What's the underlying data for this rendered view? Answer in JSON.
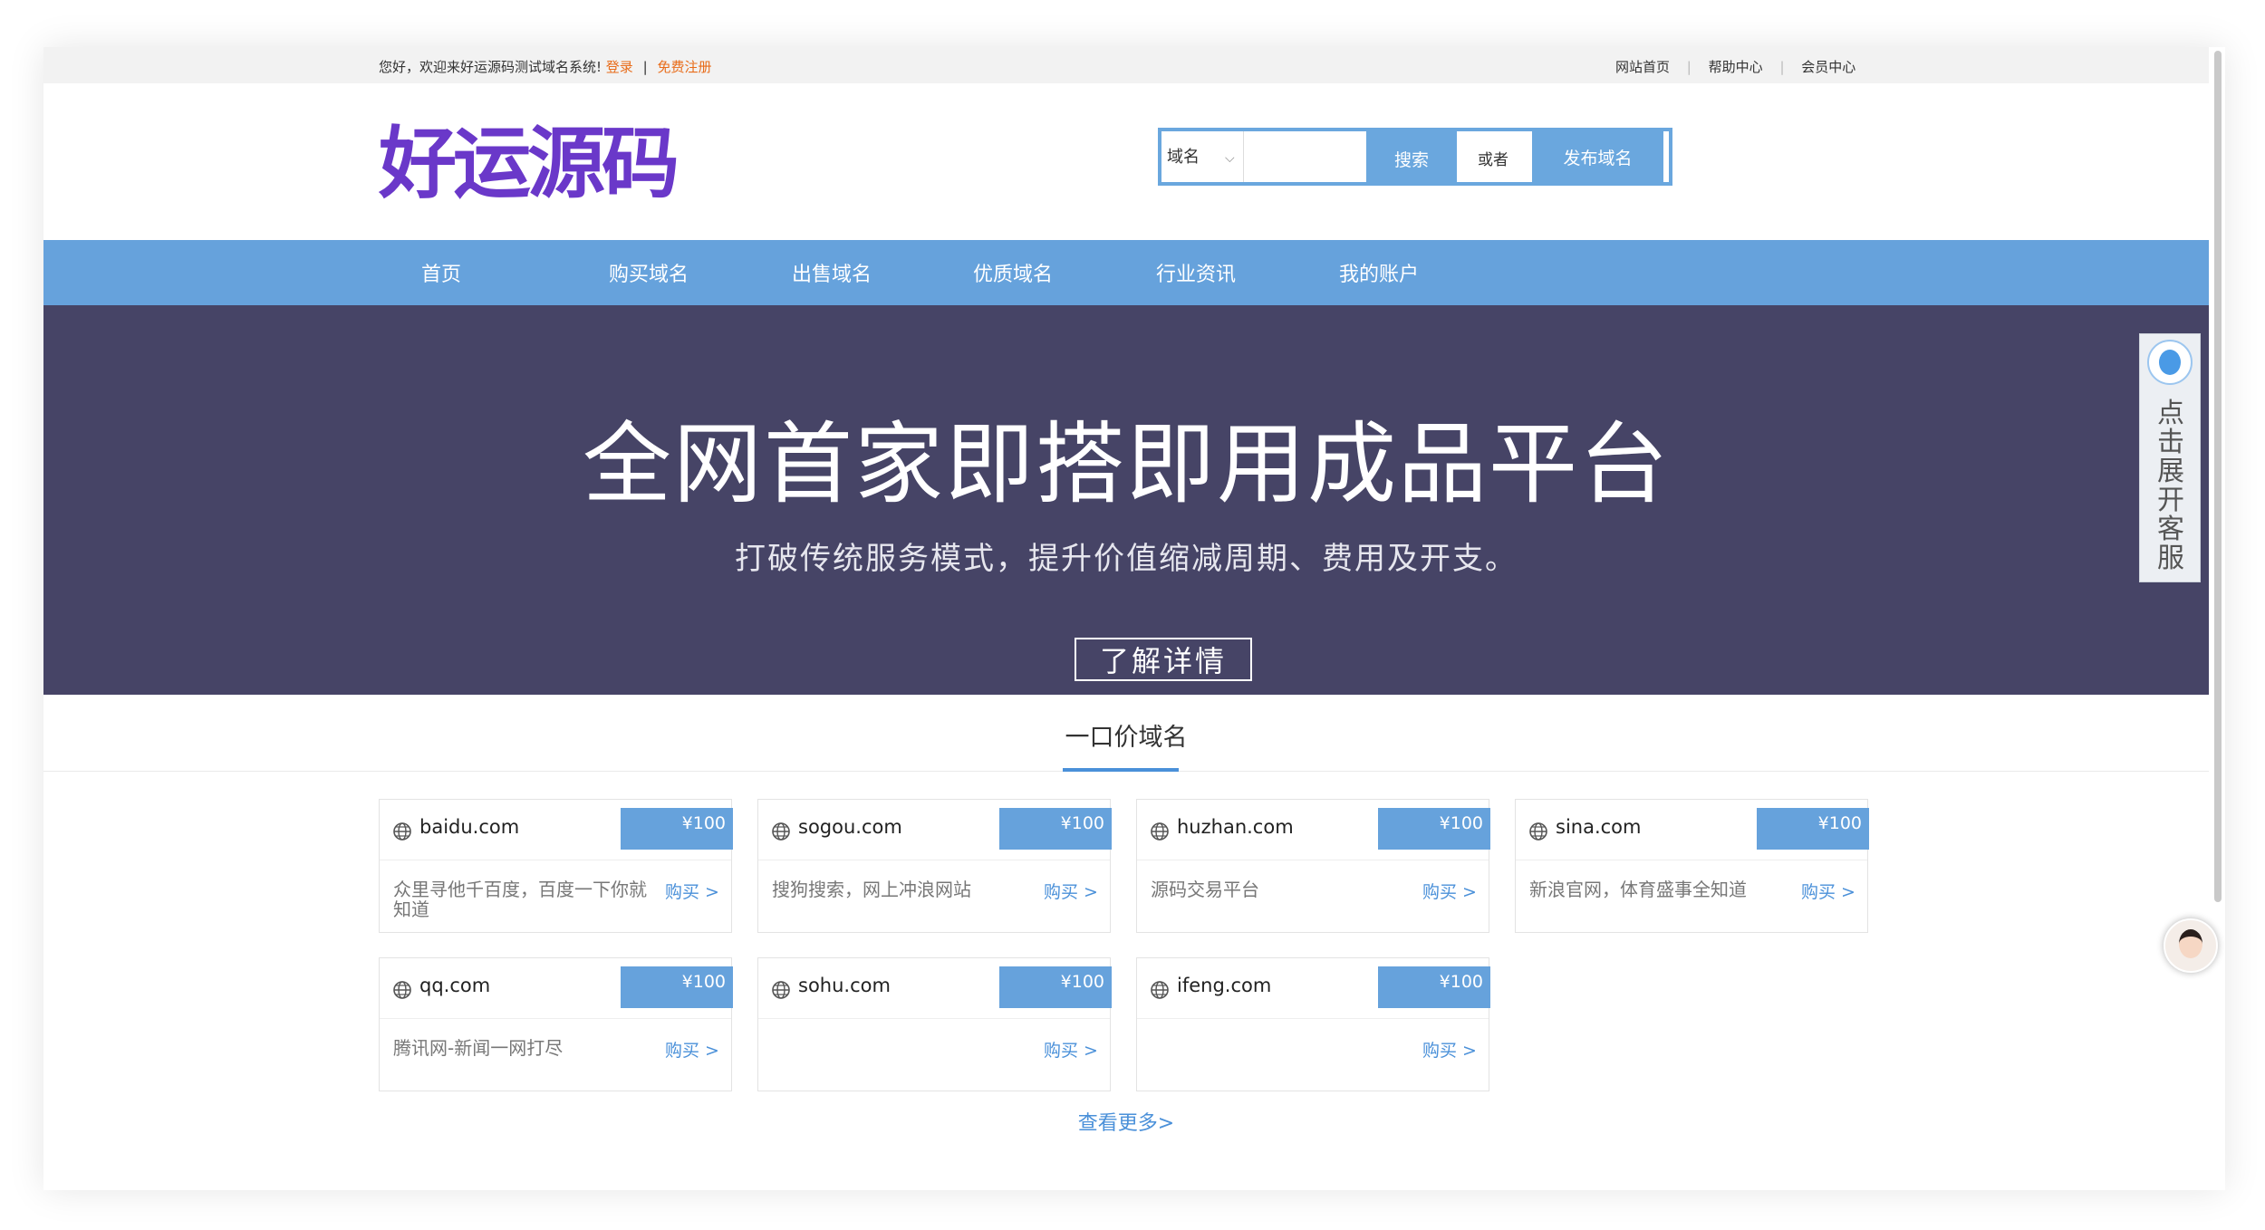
{
  "topbar": {
    "welcome": "您好，欢迎来好运源码测试域名系统!",
    "login": "登录",
    "separator": "|",
    "register": "免费注册",
    "links": [
      "网站首页",
      "帮助中心",
      "会员中心"
    ]
  },
  "header": {
    "logo": "好运源码",
    "search_type": "域名",
    "search_placeholder": "",
    "search_button": "搜索",
    "or_text": "或者",
    "publish_button": "发布域名"
  },
  "nav": [
    "首页",
    "购买域名",
    "出售域名",
    "优质域名",
    "行业资讯",
    "我的账户"
  ],
  "banner": {
    "title": "全网首家即搭即用成品平台",
    "subtitle": "打破传统服务模式，提升价值缩减周期、费用及开支。",
    "button": "了解详情"
  },
  "section": {
    "title": "一口价域名",
    "see_more": "查看更多>"
  },
  "cards": [
    {
      "domain": "baidu.com",
      "price": "¥100",
      "desc": "众里寻他千百度，百度一下你就知道",
      "buy": "购买 >"
    },
    {
      "domain": "sogou.com",
      "price": "¥100",
      "desc": "搜狗搜索，网上冲浪网站",
      "buy": "购买 >"
    },
    {
      "domain": "huzhan.com",
      "price": "¥100",
      "desc": "源码交易平台",
      "buy": "购买 >"
    },
    {
      "domain": "sina.com",
      "price": "¥100",
      "desc": "新浪官网，体育盛事全知道",
      "buy": "购买 >"
    },
    {
      "domain": "qq.com",
      "price": "¥100",
      "desc": "腾讯网-新闻一网打尽",
      "buy": "购买 >"
    },
    {
      "domain": "sohu.com",
      "price": "¥100",
      "desc": "",
      "buy": "购买 >"
    },
    {
      "domain": "ifeng.com",
      "price": "¥100",
      "desc": "",
      "buy": "购买 >"
    }
  ],
  "service": {
    "label": "点击展开客服",
    "icon": "qq-icon"
  },
  "colors": {
    "accent": "#66a2dc",
    "logo": "#6a38c9",
    "banner": "#464466",
    "link_orange": "#e86c1a"
  }
}
